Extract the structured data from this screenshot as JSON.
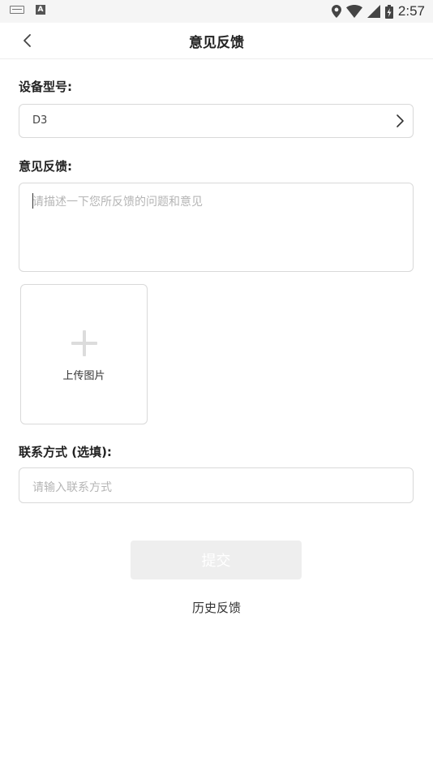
{
  "status_bar": {
    "time": "2:57",
    "icons": [
      "keyboard-icon",
      "a-icon",
      "location-icon",
      "wifi-icon",
      "signal-icon",
      "battery-charging-icon"
    ],
    "a_glyph": "A"
  },
  "header": {
    "title": "意见反馈",
    "back_icon": "chevron-left-icon"
  },
  "device": {
    "label": "设备型号:",
    "value": "D3",
    "chevron_icon": "chevron-right-icon"
  },
  "feedback": {
    "label": "意见反馈:",
    "placeholder": "请描述一下您所反馈的问题和意见"
  },
  "upload": {
    "label": "上传图片",
    "icon": "plus-icon"
  },
  "contact": {
    "label": "联系方式 (选填):",
    "placeholder": "请输入联系方式"
  },
  "actions": {
    "submit_label": "提交",
    "history_label": "历史反馈"
  },
  "colors": {
    "submit_bg": "#eeeeee",
    "placeholder": "#b5b5b5",
    "border": "#d9d9d9"
  }
}
